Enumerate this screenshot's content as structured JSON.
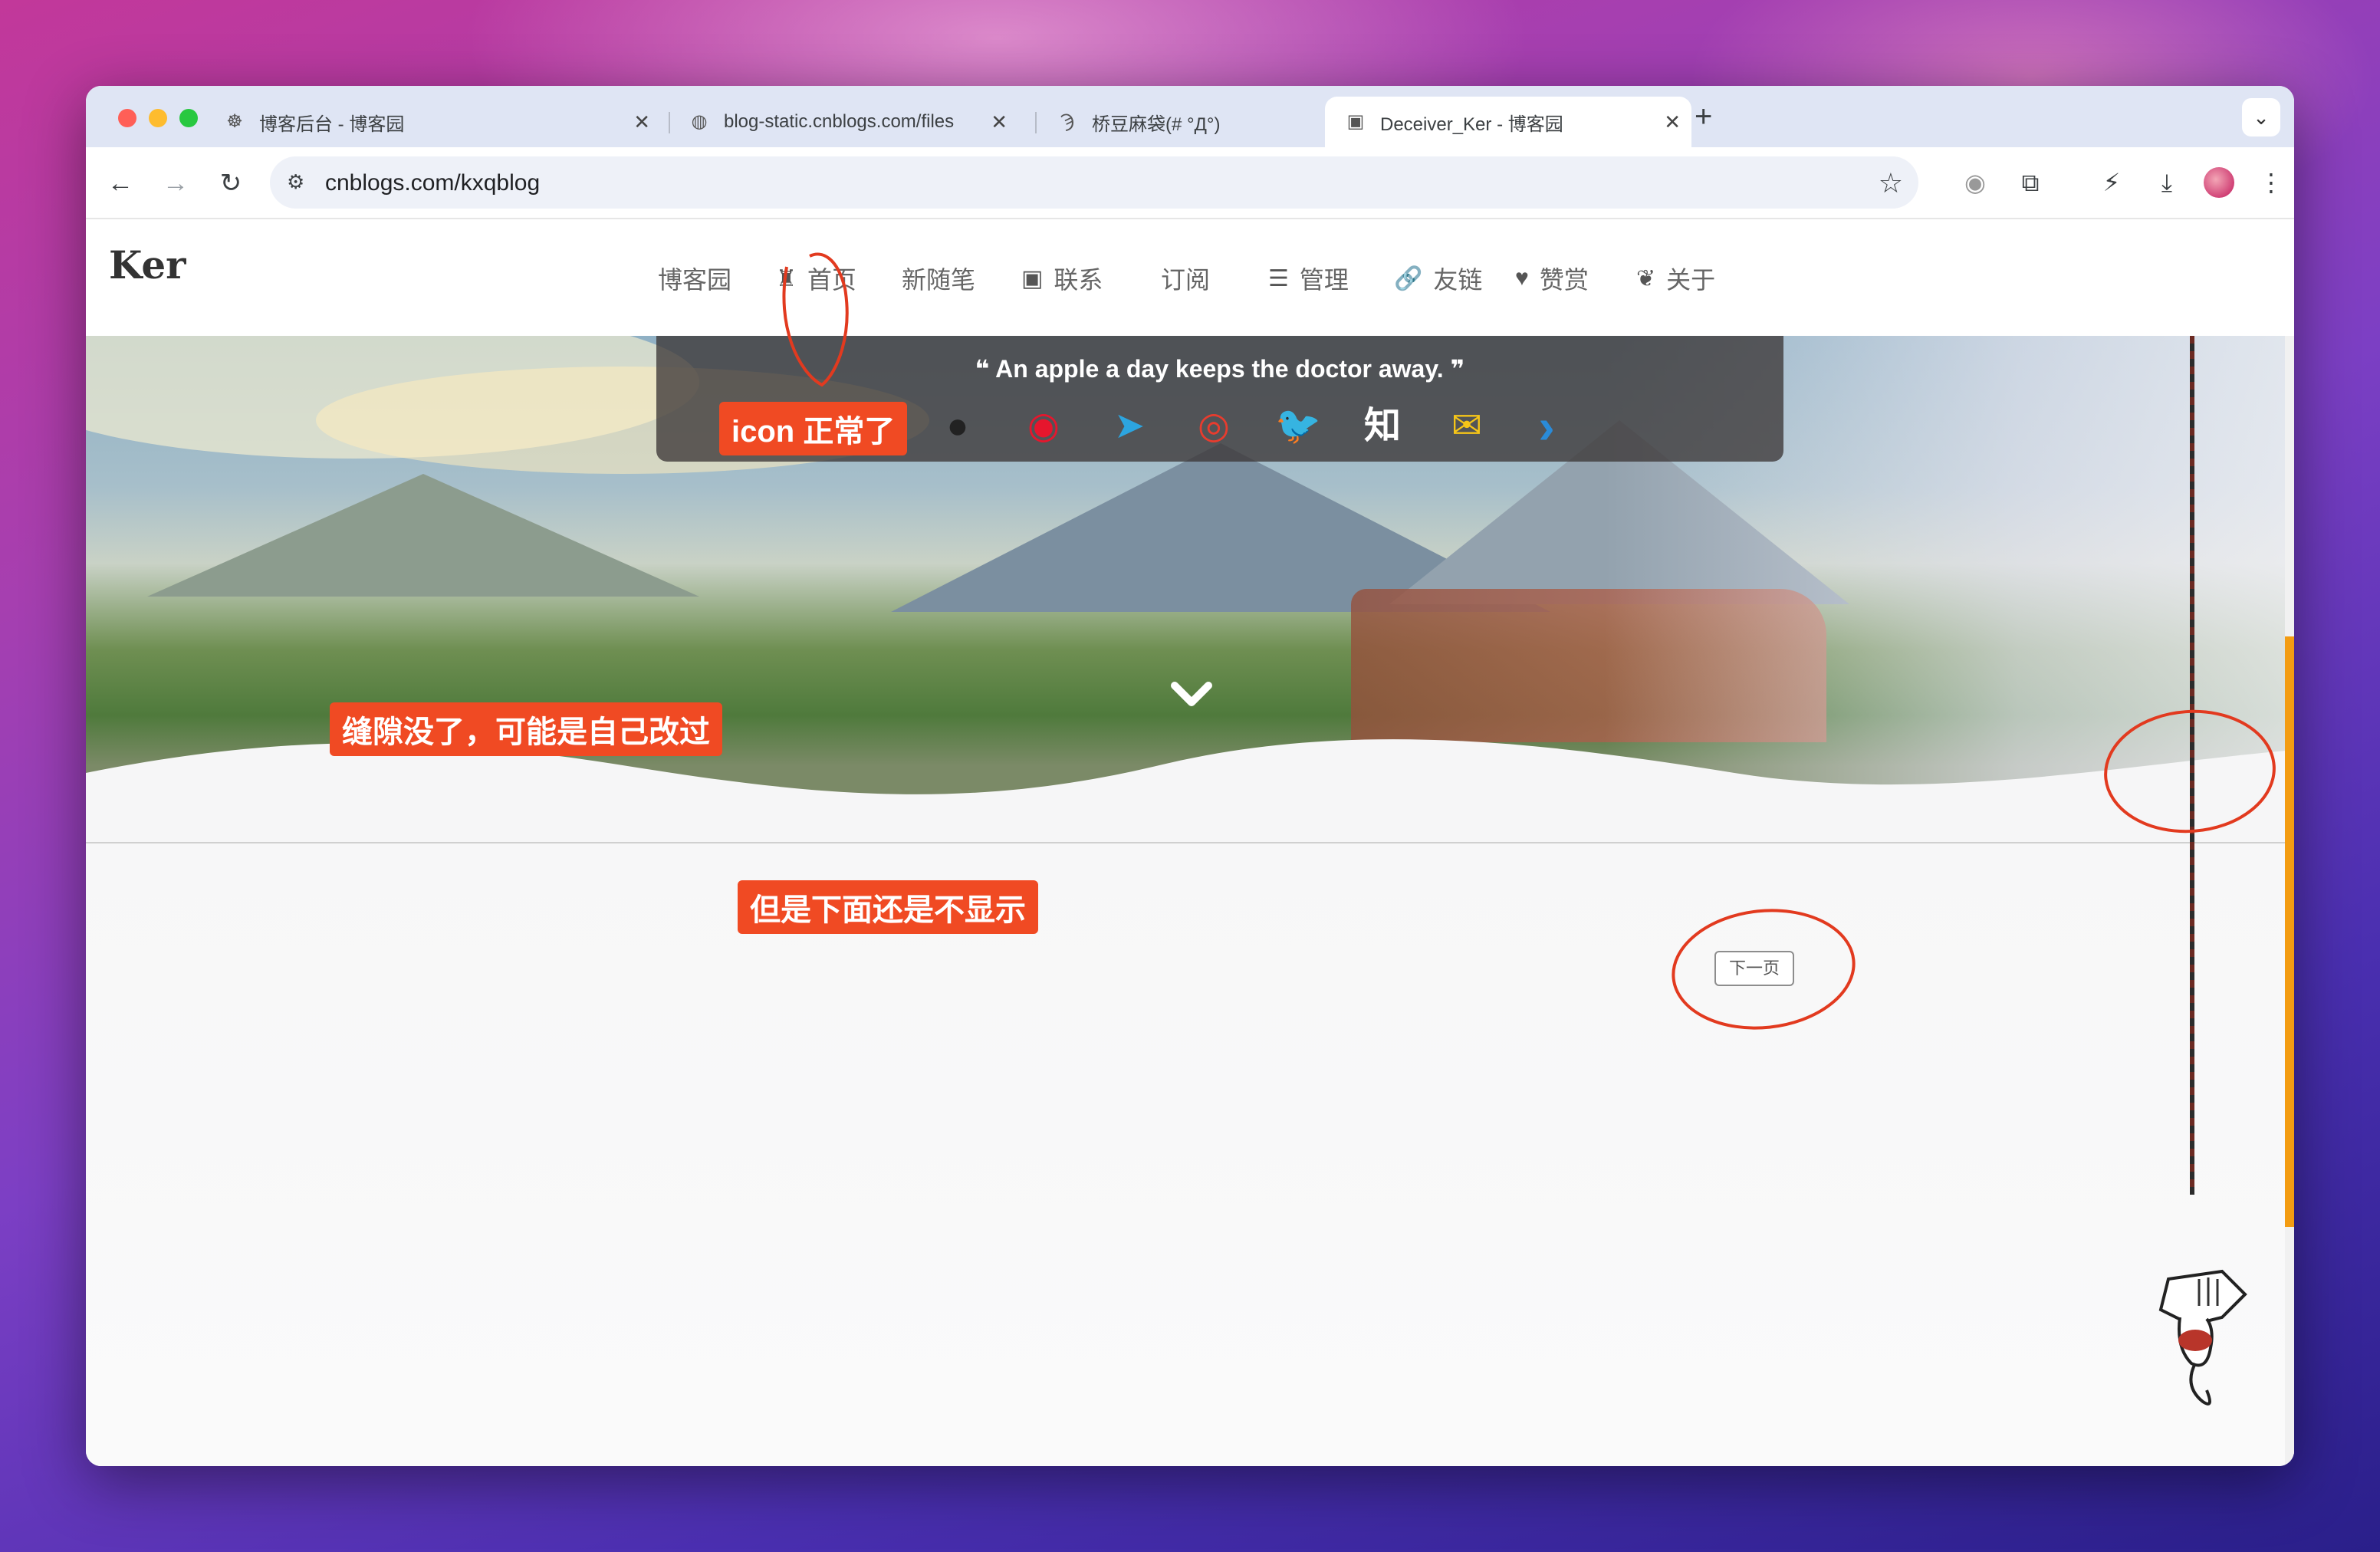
{
  "browser": {
    "tabs": [
      {
        "title": "博客后台 - 博客园",
        "icon": "cnblogs-icon",
        "active": false
      },
      {
        "title": "blog-static.cnblogs.com/files",
        "icon": "globe-icon",
        "active": false
      },
      {
        "title": "桥豆麻袋(# °Д°)",
        "icon": "site-icon",
        "active": false
      },
      {
        "title": "Deceiver_Ker - 博客园",
        "icon": "blog-icon",
        "active": true
      }
    ],
    "url": "cnblogs.com/kxqblog"
  },
  "site": {
    "logo": "Ker",
    "nav": [
      {
        "label": "博客园",
        "icon": ""
      },
      {
        "label": "首页",
        "icon": "castle-icon"
      },
      {
        "label": "新随笔",
        "icon": ""
      },
      {
        "label": "联系",
        "icon": "contact-icon"
      },
      {
        "label": "订阅",
        "icon": ""
      },
      {
        "label": "管理",
        "icon": "list-icon"
      },
      {
        "label": "友链",
        "icon": "link-icon"
      },
      {
        "label": "赞赏",
        "icon": "heart-icon"
      },
      {
        "label": "关于",
        "icon": "leaf-icon"
      }
    ],
    "quote": "An apple a day keeps the doctor away.",
    "social": [
      {
        "name": "chevron-left-icon",
        "glyph": "‹",
        "color": "#2a8bd8"
      },
      {
        "name": "github-icon",
        "glyph": "●",
        "color": "#222222"
      },
      {
        "name": "weibo-icon",
        "glyph": "◉",
        "color": "#e6162d"
      },
      {
        "name": "telegram-icon",
        "glyph": "➤",
        "color": "#2ca5e0"
      },
      {
        "name": "netease-music-icon",
        "glyph": "◎",
        "color": "#e83c2e"
      },
      {
        "name": "twitter-icon",
        "glyph": "🐦",
        "color": "#1da1f2"
      },
      {
        "name": "zhihu-icon",
        "glyph": "知",
        "color": "#ffffff"
      },
      {
        "name": "mail-icon",
        "glyph": "✉",
        "color": "#f5c518"
      },
      {
        "name": "chevron-right-icon",
        "glyph": "›",
        "color": "#2a8bd8"
      }
    ],
    "next_page": "下一页"
  },
  "annotations": [
    {
      "text": "icon 正常了"
    },
    {
      "text": "缝隙没了，可能是自己改过"
    },
    {
      "text": "但是下面还是不显示"
    }
  ],
  "colors": {
    "annotation": "#f04a23",
    "scroll_thumb": "#f39c12"
  }
}
